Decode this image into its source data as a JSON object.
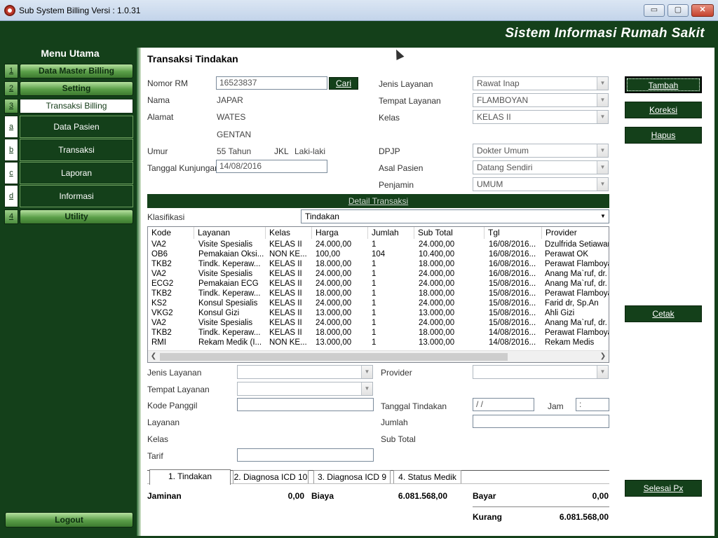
{
  "window": {
    "title": "Sub System Billing Versi : 1.0.31",
    "min": "▭",
    "max": "▢",
    "close": "✕"
  },
  "banner": {
    "title": "Sistem Informasi Rumah Sakit"
  },
  "menu": {
    "title": "Menu Utama",
    "items": [
      {
        "key": "1",
        "label": "Data Master Billing"
      },
      {
        "key": "2",
        "label": "Setting"
      },
      {
        "key": "3",
        "label": "Transaksi Billing"
      },
      {
        "key": "a",
        "label": "Data Pasien"
      },
      {
        "key": "b",
        "label": "Transaksi"
      },
      {
        "key": "c",
        "label": "Laporan"
      },
      {
        "key": "d",
        "label": "Informasi"
      },
      {
        "key": "4",
        "label": "Utility"
      }
    ],
    "logout": "Logout"
  },
  "form": {
    "title": "Transaksi Tindakan",
    "nomor_rm_label": "Nomor RM",
    "nomor_rm": "16523837",
    "cari": "Cari",
    "nama_label": "Nama",
    "nama": "JAPAR",
    "alamat_label": "Alamat",
    "alamat1": "WATES",
    "alamat2": "GENTAN",
    "umur_label": "Umur",
    "umur": "55 Tahun",
    "jkl_label": "JKL",
    "jkl": "Laki-laki",
    "tgl_kunjungan_label": "Tanggal Kunjungan",
    "tgl_kunjungan": "14/08/2016",
    "jenis_layanan_label": "Jenis Layanan",
    "jenis_layanan": "Rawat Inap",
    "tempat_layanan_label": "Tempat Layanan",
    "tempat_layanan": "FLAMBOYAN",
    "kelas_label": "Kelas",
    "kelas": "KELAS II",
    "dpjp_label": "DPJP",
    "dpjp": "Dokter Umum",
    "asal_pasien_label": "Asal Pasien",
    "asal_pasien": "Datang Sendiri",
    "penjamin_label": "Penjamin",
    "penjamin": "UMUM"
  },
  "actions": {
    "tambah": "Tambah",
    "koreksi": "Koreksi",
    "hapus": "Hapus",
    "cetak": "Cetak",
    "selesai": "Selesai Px"
  },
  "detail": {
    "bar": "Detail Transaksi",
    "klasifikasi_label": "Klasifikasi",
    "klasifikasi": "Tindakan",
    "columns": [
      "Kode",
      "Layanan",
      "Kelas",
      "Harga",
      "Jumlah",
      "Sub Total",
      "Tgl",
      "Provider"
    ],
    "rows": [
      [
        "VA2",
        "Visite Spesialis",
        "KELAS II",
        "24.000,00",
        "1",
        "24.000,00",
        "16/08/2016...",
        "Dzulfrida Setiawan,"
      ],
      [
        "OB6",
        "Pemakaian Oksi...",
        "NON KE...",
        "100,00",
        "104",
        "10.400,00",
        "16/08/2016...",
        "Perawat OK"
      ],
      [
        "TKB2",
        "Tindk. Keperaw...",
        "KELAS II",
        "18.000,00",
        "1",
        "18.000,00",
        "16/08/2016...",
        "Perawat Flamboyan"
      ],
      [
        "VA2",
        "Visite Spesialis",
        "KELAS II",
        "24.000,00",
        "1",
        "24.000,00",
        "16/08/2016...",
        "Anang Ma`ruf, dr. S"
      ],
      [
        "ECG2",
        "Pemakaian ECG",
        "KELAS II",
        "24.000,00",
        "1",
        "24.000,00",
        "15/08/2016...",
        "Anang Ma`ruf, dr. S"
      ],
      [
        "TKB2",
        "Tindk. Keperaw...",
        "KELAS II",
        "18.000,00",
        "1",
        "18.000,00",
        "15/08/2016...",
        "Perawat Flamboyan"
      ],
      [
        "KS2",
        "Konsul Spesialis",
        "KELAS II",
        "24.000,00",
        "1",
        "24.000,00",
        "15/08/2016...",
        "Farid dr, Sp.An"
      ],
      [
        "VKG2",
        "Konsul Gizi",
        "KELAS II",
        "13.000,00",
        "1",
        "13.000,00",
        "15/08/2016...",
        "Ahli Gizi"
      ],
      [
        "VA2",
        "Visite Spesialis",
        "KELAS II",
        "24.000,00",
        "1",
        "24.000,00",
        "15/08/2016...",
        "Anang Ma`ruf, dr. S"
      ],
      [
        "TKB2",
        "Tindk. Keperaw...",
        "KELAS II",
        "18.000,00",
        "1",
        "18.000,00",
        "14/08/2016...",
        "Perawat Flamboyan"
      ],
      [
        "RMI",
        "Rekam Medik (I...",
        "NON KE...",
        "13.000,00",
        "1",
        "13.000,00",
        "14/08/2016...",
        "Rekam Medis"
      ]
    ]
  },
  "entry": {
    "jenis_layanan_label": "Jenis Layanan",
    "tempat_layanan_label": "Tempat Layanan",
    "kode_panggil_label": "Kode Panggil",
    "layanan_label": "Layanan",
    "kelas_label": "Kelas",
    "tarif_label": "Tarif",
    "provider_label": "Provider",
    "tanggal_tindakan_label": "Tanggal Tindakan",
    "tanggal_tindakan": " /  /",
    "jam_label": "Jam",
    "jam": ":",
    "jumlah_label": "Jumlah",
    "sub_total_label": "Sub Total"
  },
  "tabs": [
    "1. Tindakan",
    "2. Diagnosa ICD 10",
    "3. Diagnosa ICD 9",
    "4. Status Medik"
  ],
  "summary": {
    "jaminan_label": "Jaminan",
    "jaminan": "0,00",
    "biaya_label": "Biaya",
    "biaya": "6.081.568,00",
    "bayar_label": "Bayar",
    "bayar": "0,00",
    "kurang_label": "Kurang",
    "kurang": "6.081.568,00"
  }
}
